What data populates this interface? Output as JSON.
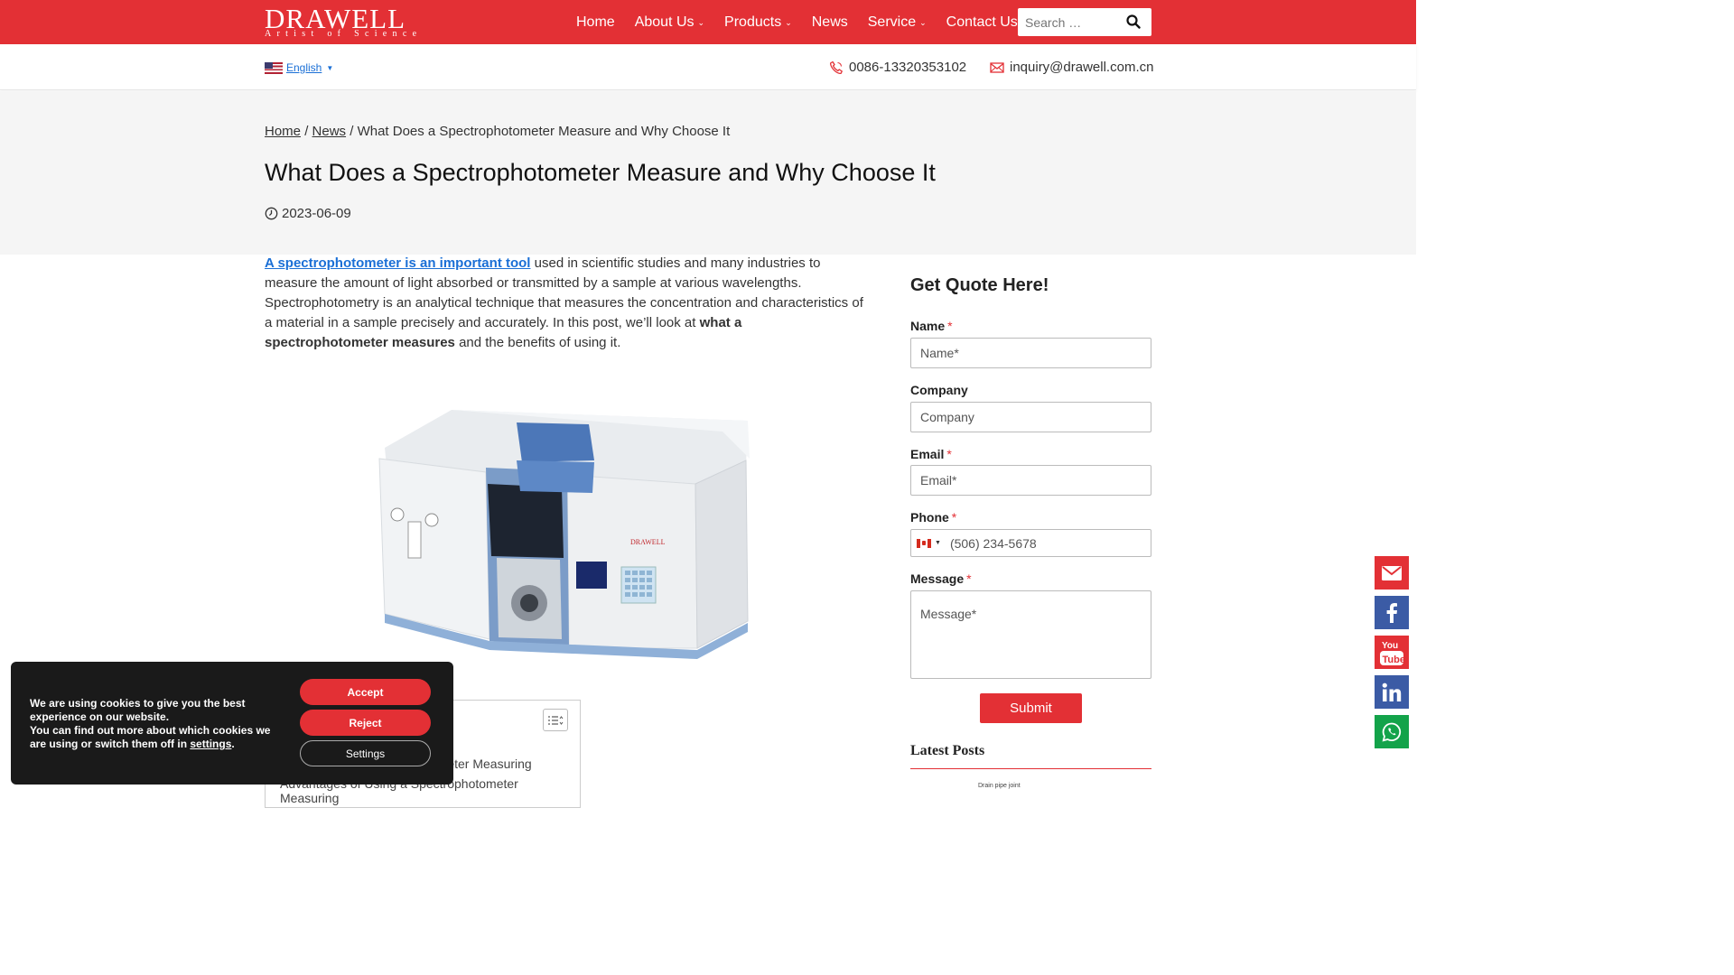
{
  "header": {
    "logo_brand": "DRAWELL",
    "logo_tagline": "Artist of Science",
    "nav": [
      {
        "label": "Home",
        "has_dropdown": false
      },
      {
        "label": "About Us",
        "has_dropdown": true
      },
      {
        "label": "Products",
        "has_dropdown": true
      },
      {
        "label": "News",
        "has_dropdown": false
      },
      {
        "label": "Service",
        "has_dropdown": true
      },
      {
        "label": "Contact Us",
        "has_dropdown": false
      }
    ],
    "search_placeholder": "Search …",
    "brand_color": "#e33035"
  },
  "subbar": {
    "language": "English",
    "phone": "0086-13320353102",
    "email": "inquiry@drawell.com.cn"
  },
  "hero": {
    "breadcrumb": {
      "home": "Home",
      "news": "News",
      "current": "What Does a Spectrophotometer Measure and Why Choose It",
      "sep": "/"
    },
    "title": "What Does a Spectrophotometer Measure and Why Choose It",
    "date": "2023-06-09"
  },
  "article": {
    "lead_link": "A spectrophotometer is an important tool",
    "p1_a": " used in scientific studies and many industries to measure the amount of light absorbed or transmitted by a sample at various wavelengths. Spectrophotometry is an analytical technique that measures the concentration and characteristics of a material in a sample precisely and accurately. In this post, we’ll look at ",
    "p1_bold": "what a spectrophotometer measures",
    "p1_b": " and the benefits of using it.",
    "image_brand": "DRAWELL",
    "toc_items": [
      "tometer Measuring",
      "Advantages of Using a Spectrophotometer Measuring"
    ]
  },
  "form": {
    "title": "Get Quote Here!",
    "fields": {
      "name": {
        "label": "Name",
        "required": "*",
        "placeholder": "Name*"
      },
      "company": {
        "label": "Company",
        "placeholder": "Company"
      },
      "email": {
        "label": "Email",
        "required": "*",
        "placeholder": "Email*"
      },
      "phone": {
        "label": "Phone",
        "required": "*",
        "placeholder": "(506) 234-5678"
      },
      "message": {
        "label": "Message",
        "required": "*",
        "placeholder": "Message*"
      }
    },
    "submit": "Submit",
    "latest_posts": "Latest Posts",
    "latest_thumb_label": "Drain pipe joint"
  },
  "social": [
    "email-icon",
    "facebook-icon",
    "youtube-icon",
    "linkedin-icon",
    "whatsapp-icon"
  ],
  "cookie": {
    "line1": "We are using cookies to give you the best experience on our website.",
    "line2": "You can find out more about which cookies we are using or switch them off in",
    "settings_link": "settings",
    "period": ".",
    "accept": "Accept",
    "reject": "Reject",
    "settings": "Settings"
  }
}
